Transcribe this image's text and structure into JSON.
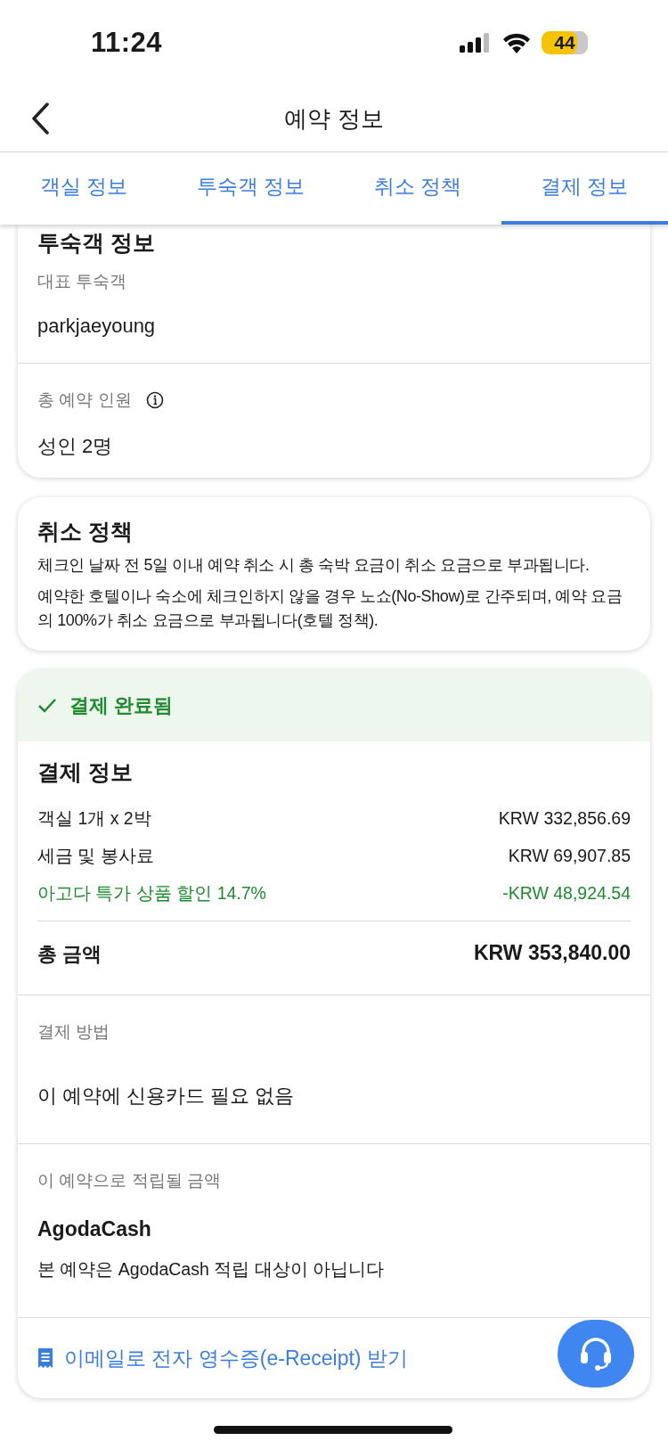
{
  "status_bar": {
    "time": "11:24",
    "battery": "44"
  },
  "header": {
    "title": "예약 정보"
  },
  "tabs": [
    {
      "label": "객실 정보",
      "selected": false
    },
    {
      "label": "투숙객 정보",
      "selected": false
    },
    {
      "label": "취소 정책",
      "selected": false
    },
    {
      "label": "결제 정보",
      "selected": true
    }
  ],
  "guest_card": {
    "title": "투숙객 정보",
    "main_guest_label": "대표 투숙객",
    "main_guest": "parkjaeyoung",
    "occupancy_label": "총 예약 인원",
    "occupancy": "성인 2명"
  },
  "cancellation_card": {
    "title": "취소 정책",
    "paragraphs": [
      "체크인 날짜 전 5일 이내 예약 취소 시 총 숙박 요금이 취소 요금으로 부과됩니다.",
      "예약한 호텔이나 숙소에 체크인하지 않을 경우 노쇼(No-Show)로 간주되며, 예약 요금의 100%가 취소 요금으로 부과됩니다(호텔 정책)."
    ]
  },
  "payment_card": {
    "status": "결제 완료됨",
    "title": "결제 정보",
    "lines": [
      {
        "label": "객실 1개 x 2박",
        "amount": "KRW 332,856.69",
        "kind": "charge"
      },
      {
        "label": "세금 및 봉사료",
        "amount": "KRW 69,907.85",
        "kind": "charge"
      },
      {
        "label": "아고다 특가 상품 할인 14.7%",
        "amount": "-KRW 48,924.54",
        "kind": "discount"
      }
    ],
    "total_label": "총 금액",
    "total": "KRW 353,840.00",
    "method_label": "결제 방법",
    "method": "이 예약에 신용카드 필요 없음",
    "reward_label": "이 예약으로 적립될 금액",
    "reward_title": "AgodaCash",
    "reward_note": "본 예약은 AgodaCash 적립 대상이 아닙니다",
    "receipt_link": "이메일로 전자 영수증(e-Receipt) 받기"
  }
}
